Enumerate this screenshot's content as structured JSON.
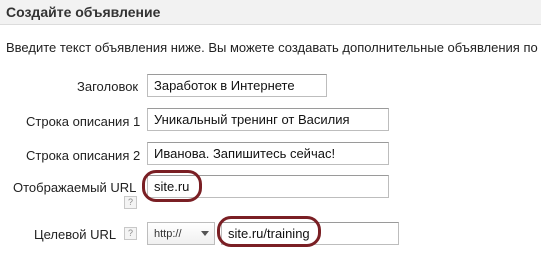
{
  "header": {
    "title": "Создайте объявление"
  },
  "intro_text": "Введите текст объявления ниже. Вы можете создавать дополнительные объявления по",
  "form": {
    "headline": {
      "label": "Заголовок",
      "value": "Заработок в Интернете"
    },
    "desc_line_1": {
      "label": "Строка описания 1",
      "value": "Уникальный тренинг от Василия"
    },
    "desc_line_2": {
      "label": "Строка описания 2",
      "value": "Иванова. Запишитесь сейчас!"
    },
    "display_url": {
      "label": "Отображаемый URL",
      "value": "site.ru",
      "help": "?"
    },
    "target_url": {
      "label": "Целевой URL",
      "help": "?",
      "protocol": "http://",
      "value": "site.ru/training"
    }
  },
  "colors": {
    "highlight": "#7a1f24",
    "header_bg": "#f2f2f2"
  },
  "icons": {
    "help": "help-icon",
    "dropdown": "chevron-down-icon"
  }
}
